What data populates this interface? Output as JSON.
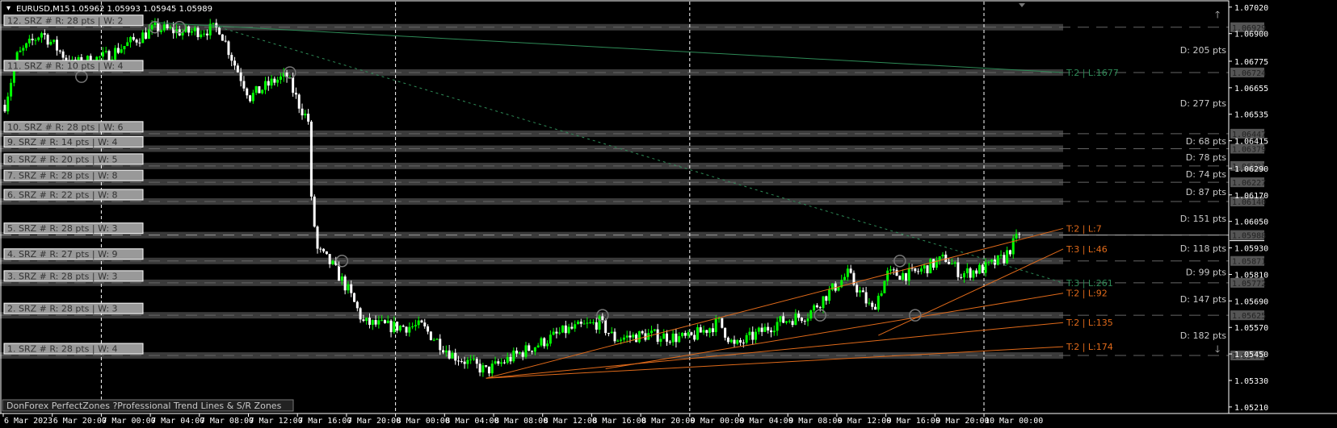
{
  "header": {
    "symbol": "EURUSD,M15",
    "ohlc": "1.05962 1.05993 1.05945 1.05989"
  },
  "footer_label": "DonForex PerfectZones ?Professional Trend Lines & S/R Zones",
  "colors": {
    "bull": "#00ff00",
    "bear": "#ffffff",
    "trend_green": "#2e8b57",
    "trend_orange": "#e06a1a",
    "zone": "#3a3a3a"
  },
  "chart_data": {
    "type": "candlestick",
    "title": "EURUSD,M15",
    "ylim": [
      1.0521,
      1.0702
    ],
    "y_ticks": [
      "1.07020",
      "1.06900",
      "1.06775",
      "1.06655",
      "1.06535",
      "1.06415",
      "1.06290",
      "1.06170",
      "1.06050",
      "1.05930",
      "1.05810",
      "1.05690",
      "1.05570",
      "1.05450",
      "1.05330",
      "1.05210"
    ],
    "x_ticks": [
      "6 Mar 2023",
      "6 Mar 20:00",
      "7 Mar 00:00",
      "7 Mar 04:00",
      "7 Mar 08:00",
      "7 Mar 12:00",
      "7 Mar 16:00",
      "7 Mar 20:00",
      "8 Mar 00:00",
      "8 Mar 04:00",
      "8 Mar 08:00",
      "8 Mar 12:00",
      "8 Mar 16:00",
      "8 Mar 20:00",
      "9 Mar 00:00",
      "9 Mar 04:00",
      "9 Mar 08:00",
      "9 Mar 12:00",
      "9 Mar 16:00",
      "9 Mar 20:00",
      "10 Mar 00:00"
    ],
    "day_separators": [
      "7 Mar 00:00",
      "8 Mar 00:00",
      "9 Mar 00:00",
      "10 Mar 00:00"
    ],
    "bars_per_tick": 16,
    "price_path": [
      [
        0,
        1.06578
      ],
      [
        4,
        1.06797
      ],
      [
        12,
        1.06906
      ],
      [
        22,
        1.0676
      ],
      [
        33,
        1.06797
      ],
      [
        49,
        1.06924
      ],
      [
        59,
        1.06906
      ],
      [
        70,
        1.06924
      ],
      [
        75,
        1.0676
      ],
      [
        80,
        1.06614
      ],
      [
        88,
        1.06687
      ],
      [
        92,
        1.06705
      ],
      [
        96,
        1.06578
      ],
      [
        99,
        1.06505
      ],
      [
        100,
        1.0614
      ],
      [
        102,
        1.05921
      ],
      [
        107,
        1.05848
      ],
      [
        112,
        1.05738
      ],
      [
        117,
        1.05592
      ],
      [
        125,
        1.05574
      ],
      [
        136,
        1.05574
      ],
      [
        146,
        1.05446
      ],
      [
        157,
        1.05373
      ],
      [
        167,
        1.05446
      ],
      [
        183,
        1.05556
      ],
      [
        194,
        1.05592
      ],
      [
        199,
        1.05519
      ],
      [
        210,
        1.05537
      ],
      [
        223,
        1.05519
      ],
      [
        233,
        1.05592
      ],
      [
        238,
        1.05483
      ],
      [
        252,
        1.05592
      ],
      [
        262,
        1.05629
      ],
      [
        267,
        1.05702
      ],
      [
        275,
        1.05811
      ],
      [
        283,
        1.05647
      ],
      [
        288,
        1.05811
      ],
      [
        296,
        1.05811
      ],
      [
        307,
        1.05884
      ],
      [
        312,
        1.05811
      ],
      [
        320,
        1.0584
      ],
      [
        326,
        1.05884
      ],
      [
        331,
        1.05989
      ]
    ],
    "current_price": "1.05988",
    "zones": [
      {
        "label": "12. SRZ # R: 28 pts | W: 2",
        "price": "1.06929"
      },
      {
        "label": "11. SRZ # R: 10 pts | W: 4",
        "price": "1.06724"
      },
      {
        "label": "10. SRZ # R: 28 pts | W: 6",
        "price": "1.06447"
      },
      {
        "label": "9. SRZ # R: 14 pts | W: 4",
        "price": "1.06379"
      },
      {
        "label": "8. SRZ # R: 20 pts | W: 5",
        "price": "1.06301"
      },
      {
        "label": "7. SRZ # R: 28 pts | W: 8",
        "price": "1.06227"
      },
      {
        "label": "6. SRZ # R: 22 pts | W: 8",
        "price": "1.06140"
      },
      {
        "label": "5. SRZ # R: 28 pts | W: 3",
        "price": "1.05988"
      },
      {
        "label": "4. SRZ # R: 27 pts | W: 9",
        "price": "1.05871"
      },
      {
        "label": "3. SRZ # R: 28 pts | W: 3",
        "price": "1.05772"
      },
      {
        "label": "2. SRZ # R: 28 pts | W: 3",
        "price": "1.05625"
      },
      {
        "label": "1. SRZ # R: 28 pts | W: 4",
        "price": "1.05443"
      }
    ],
    "distances": [
      {
        "text": "D: 205 pts",
        "price": 1.06826
      },
      {
        "text": "D: 277 pts",
        "price": 1.06585
      },
      {
        "text": "D: 68 pts",
        "price": 1.06413
      },
      {
        "text": "D: 78 pts",
        "price": 1.0634
      },
      {
        "text": "D: 74 pts",
        "price": 1.06264
      },
      {
        "text": "D: 87 pts",
        "price": 1.06184
      },
      {
        "text": "D: 151 pts",
        "price": 1.06064
      },
      {
        "text": "D: 118 pts",
        "price": 1.05929
      },
      {
        "text": "D: 99 pts",
        "price": 1.05821
      },
      {
        "text": "D: 147 pts",
        "price": 1.05698
      },
      {
        "text": "D: 182 pts",
        "price": 1.05534
      }
    ],
    "trend_lines": [
      {
        "label": "T:2 | L:1677",
        "color": "green",
        "style": "solid",
        "from": [
          49,
          1.0695
        ],
        "to": [
          345,
          1.06724
        ]
      },
      {
        "label": "T:3 | L:261",
        "color": "green",
        "style": "dotted",
        "from": [
          70,
          1.06929
        ],
        "to": [
          345,
          1.05772
        ]
      },
      {
        "label": "T:2 | L:7",
        "color": "orange",
        "style": "solid",
        "from": [
          157,
          1.0534
        ],
        "to": [
          345,
          1.06018
        ]
      },
      {
        "label": "T:3 | L:46",
        "color": "orange",
        "style": "solid",
        "from": [
          285,
          1.05534
        ],
        "to": [
          345,
          1.05925
        ]
      },
      {
        "label": "T:2 | L:92",
        "color": "orange",
        "style": "solid",
        "from": [
          196,
          1.05383
        ],
        "to": [
          345,
          1.05725
        ]
      },
      {
        "label": "T:2 | L:135",
        "color": "orange",
        "style": "solid",
        "from": [
          157,
          1.0534
        ],
        "to": [
          345,
          1.05592
        ]
      },
      {
        "label": "T:2 | L:174",
        "color": "orange",
        "style": "solid",
        "from": [
          157,
          1.0534
        ],
        "to": [
          345,
          1.05483
        ]
      }
    ],
    "swing_circles": [
      [
        49,
        1.06929
      ],
      [
        57,
        1.06929
      ],
      [
        25,
        1.06705
      ],
      [
        93,
        1.06724
      ],
      [
        110,
        1.05871
      ],
      [
        195,
        1.05625
      ],
      [
        266,
        1.05625
      ],
      [
        292,
        1.05871
      ],
      [
        297,
        1.05625
      ]
    ]
  }
}
